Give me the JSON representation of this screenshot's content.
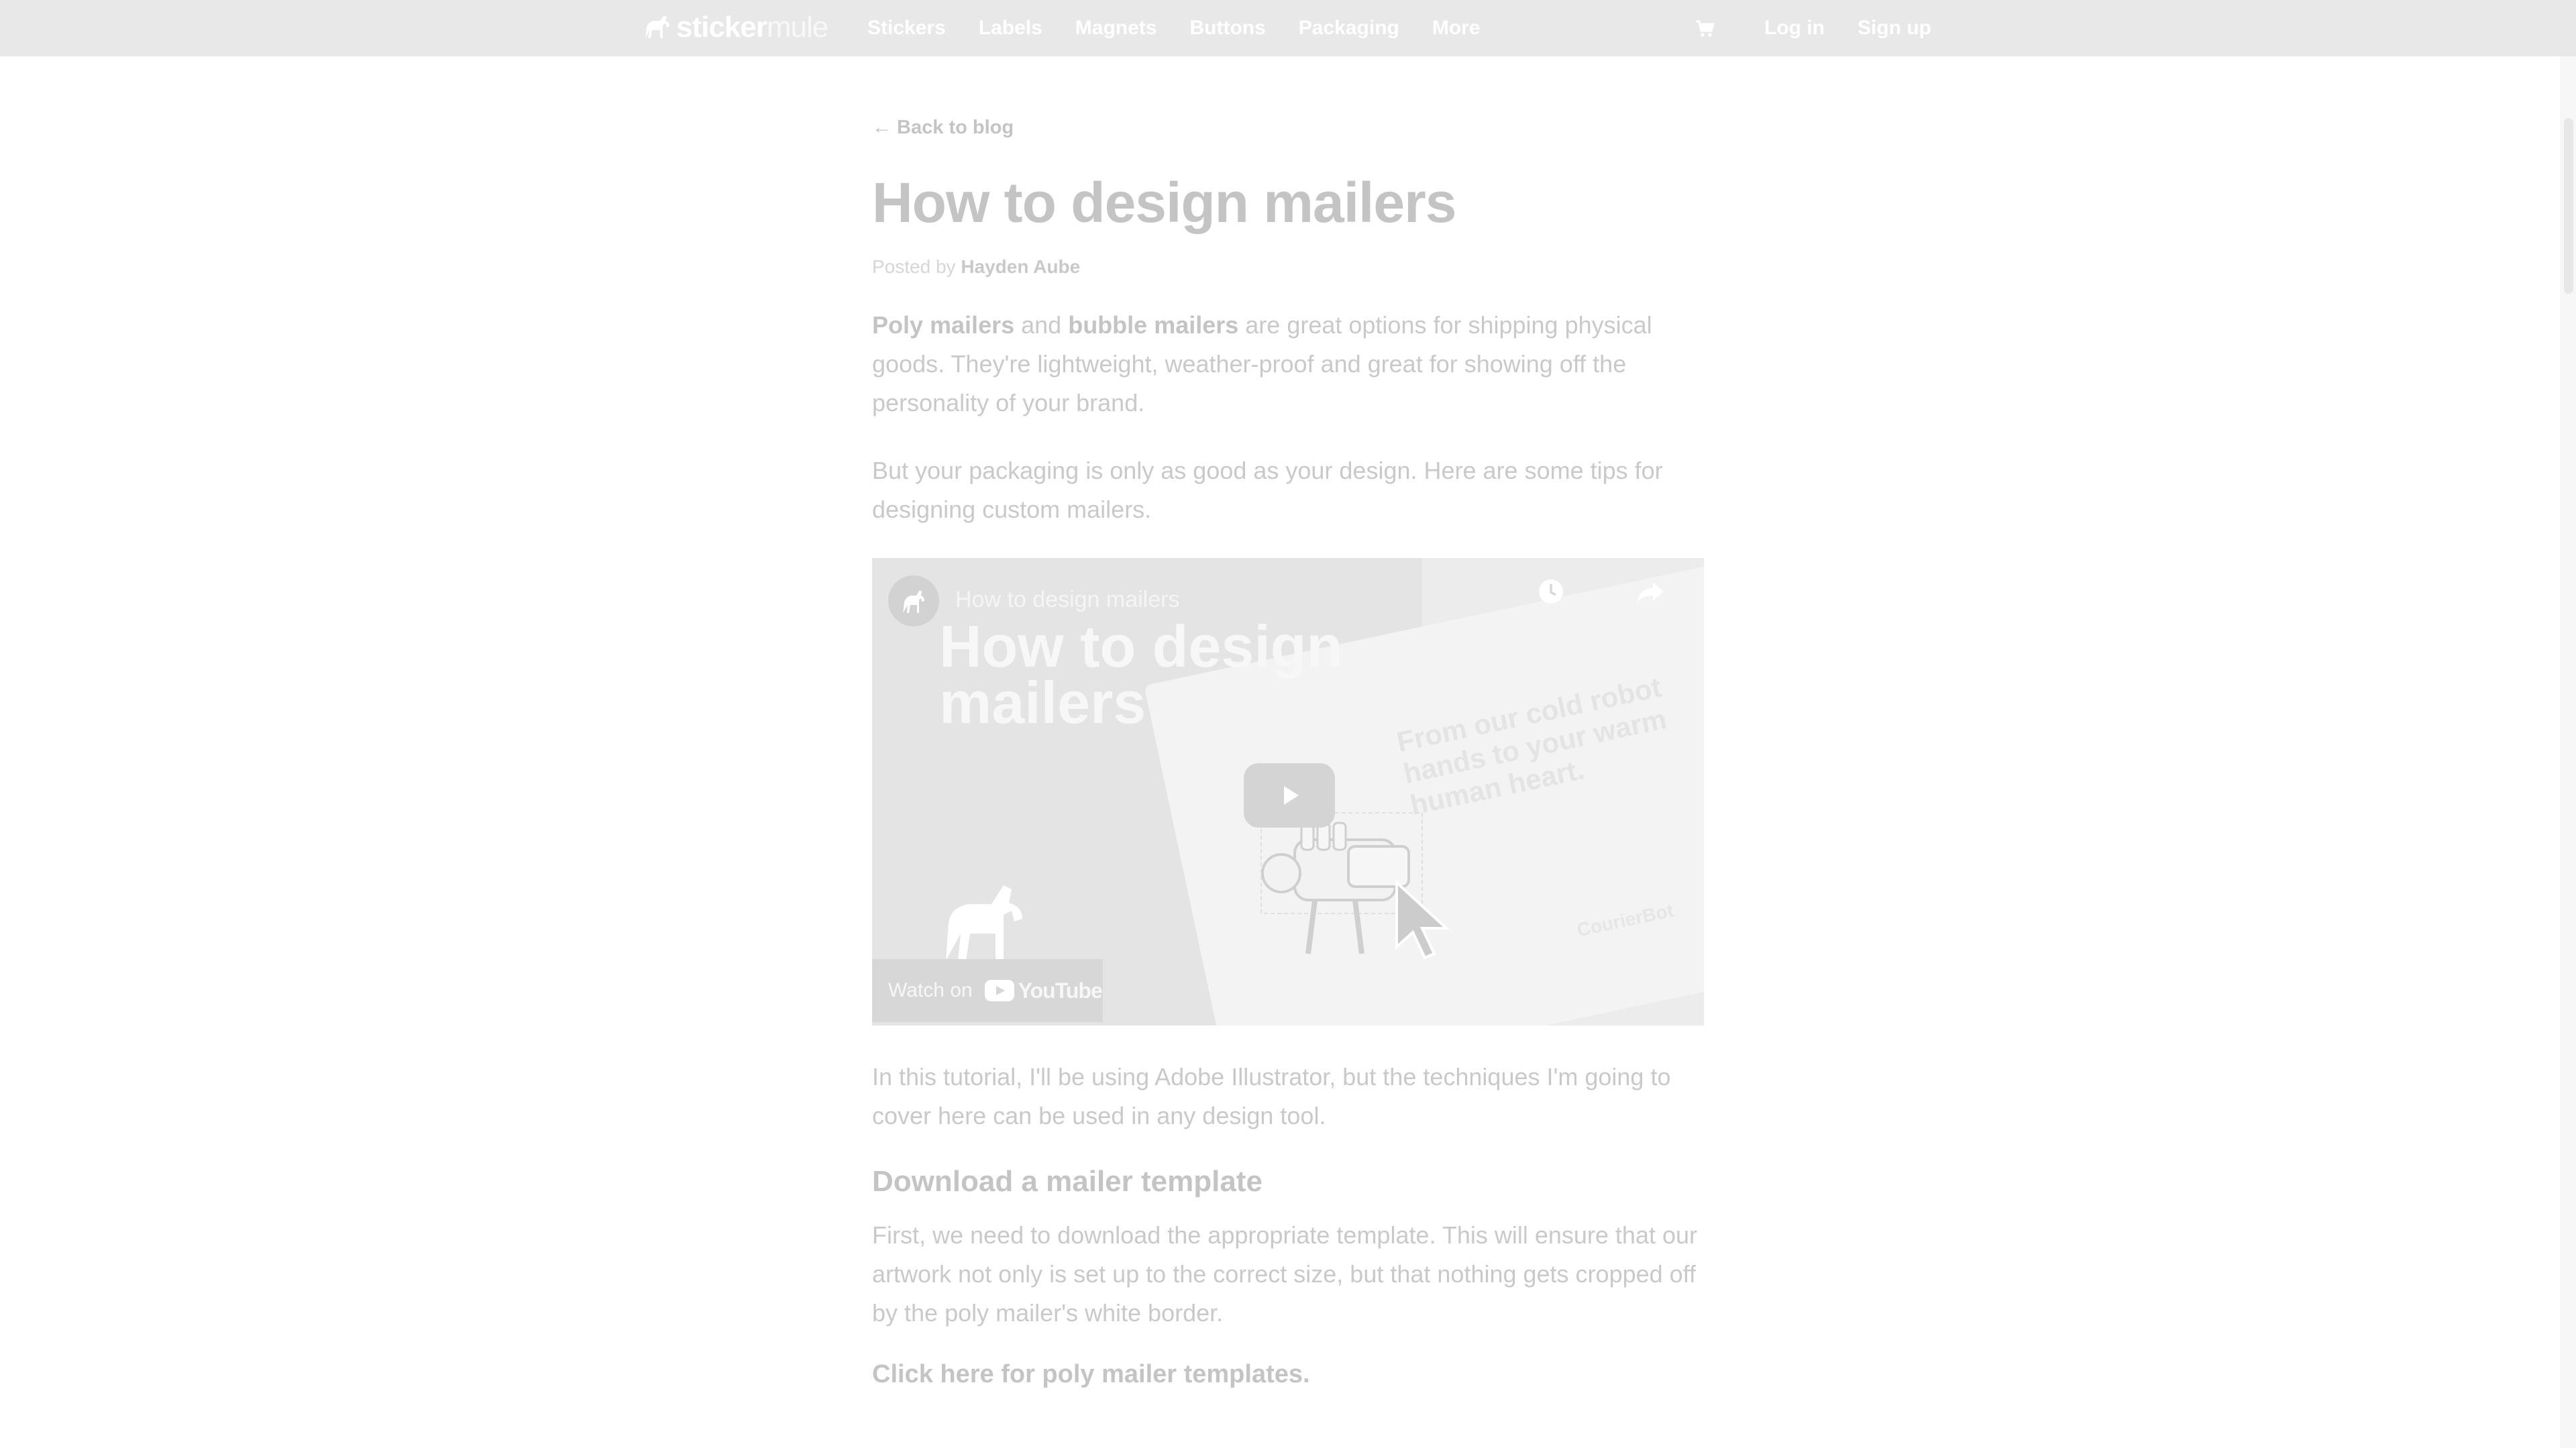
{
  "brand": {
    "word1": "sticker",
    "word2": "mule"
  },
  "nav": {
    "items": [
      {
        "label": "Stickers"
      },
      {
        "label": "Labels"
      },
      {
        "label": "Magnets"
      },
      {
        "label": "Buttons"
      },
      {
        "label": "Packaging"
      },
      {
        "label": "More"
      }
    ],
    "cart_icon": "cart-icon",
    "login_label": "Log in",
    "signup_label": "Sign up"
  },
  "article": {
    "back_label": "← Back to blog",
    "title": "How to design mailers",
    "byline_prefix": "Posted by",
    "author": "Hayden Aube",
    "p1": {
      "link1": "Poly mailers",
      "text1": " and ",
      "link2": "bubble mailers",
      "text2": " are great options for shipping physical goods. They're lightweight, weather-proof and great for showing off the personality of your brand."
    },
    "p2": "But your packaging is only as good as your design. Here are some tips for designing custom mailers.",
    "video": {
      "title": "How to design mailers",
      "big_title": "How to design mailers",
      "slogan": "From our cold robot hands to your warm human heart.",
      "brand_small": "CourierBot",
      "watch_label": "Watch on",
      "youtube_label": "YouTube",
      "icons": [
        "channel-icon",
        "clock-icon",
        "share-icon",
        "play-icon",
        "horse-icon"
      ]
    },
    "p3": "In this tutorial, I'll be using Adobe Illustrator, but the techniques I'm going to cover here can be used in any design tool.",
    "h2": "Download a mailer template",
    "p4": "First, we need to download the appropriate template. This will ensure that our artwork not only is set up to the correct size, but that nothing gets cropped off by the poly mailer's white border.",
    "cta": "Click here for poly mailer templates."
  },
  "colors": {
    "topbar": "#e8e8e8",
    "text": "#c9c9c9",
    "heading": "#c4c4c4"
  }
}
